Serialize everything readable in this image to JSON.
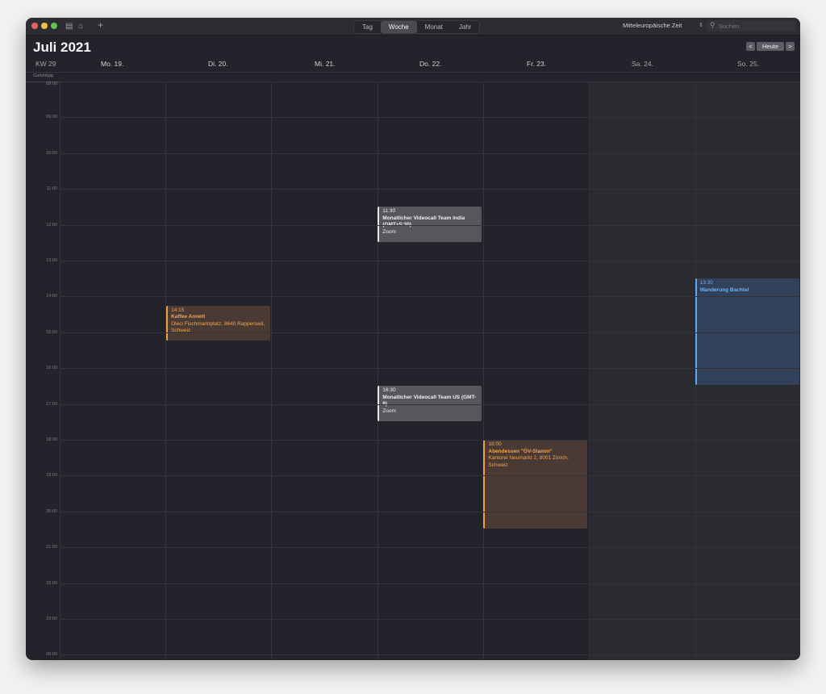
{
  "toolbar": {
    "view_tabs": [
      "Tag",
      "Woche",
      "Monat",
      "Jahr"
    ],
    "active_view": "Woche",
    "add_label": "+",
    "timezone": "Mitteleuropäische Zeit",
    "search_placeholder": "Suchen"
  },
  "header": {
    "month_title": "Juli 2021",
    "week_number": "KW 29",
    "today_label": "Heute",
    "prev_label": "<",
    "next_label": ">",
    "days": [
      "Mo. 19.",
      "Di. 20.",
      "Mi. 21.",
      "Do. 22.",
      "Fr. 23.",
      "Sa. 24.",
      "So. 25."
    ]
  },
  "allday_label": "Ganztägig",
  "hours": [
    "08:00",
    "09:00",
    "10:00",
    "11:00",
    "12:00",
    "13:00",
    "14:00",
    "15:00",
    "16:00",
    "17:00",
    "18:00",
    "19:00",
    "20:00",
    "21:00",
    "22:00",
    "23:00",
    "00:00"
  ],
  "events": [
    {
      "day_index": 3,
      "start_hour": 11.5,
      "end_hour": 12.5,
      "time": "11:30",
      "title": "Monatlicher Videocall Team India (GMT+5:30)",
      "location": "Zoom",
      "color": "gray"
    },
    {
      "day_index": 1,
      "start_hour": 14.25,
      "end_hour": 15.25,
      "time": "14:15",
      "title": "Kaffee Annett",
      "location": "Oleci Fischmarktplatz, 8640 Rapperswil, Schweiz",
      "color": "orange"
    },
    {
      "day_index": 6,
      "start_hour": 13.5,
      "end_hour": 16.5,
      "time": "13:30",
      "title": "Wanderung Bachtel",
      "location": "",
      "color": "blue"
    },
    {
      "day_index": 3,
      "start_hour": 16.5,
      "end_hour": 17.5,
      "time": "16:30",
      "title": "Monatlicher Videocall Team US (GMT-8)",
      "location": "Zoom",
      "color": "gray"
    },
    {
      "day_index": 4,
      "start_hour": 18.0,
      "end_hour": 20.5,
      "time": "18:00",
      "title": "Abendessen \"ÖV-Stamm\"",
      "location": "Kantorei Neumarkt 2, 8001 Zürich, Schweiz",
      "color": "orange"
    }
  ],
  "colors": {
    "gray": "#56575d",
    "orange": "#f0a13a",
    "blue": "#5aa7f2"
  }
}
